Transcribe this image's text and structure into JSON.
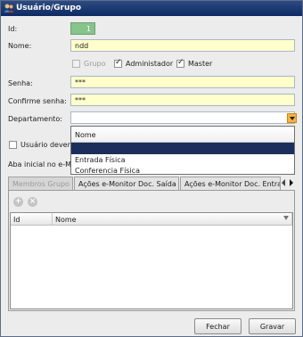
{
  "window": {
    "title": "Usuário/Grupo",
    "icon": "user-group-icon"
  },
  "form": {
    "id_label": "Id:",
    "id_value": "1",
    "nome_label": "Nome:",
    "nome_value": "ndd",
    "grupo_label": "Grupo",
    "grupo_checked": false,
    "grupo_enabled": false,
    "administrador_label": "Administador",
    "administrador_checked": true,
    "master_label": "Master",
    "master_checked": true,
    "senha_label": "Senha:",
    "senha_value": "***",
    "confirme_label": "Confirme senha:",
    "confirme_value": "***",
    "departamento_label": "Departamento:",
    "departamento_value": "",
    "usuario_devera_label": "Usuário deverá",
    "usuario_devera_checked": false,
    "aba_inicial_label": "Aba inicial no e-Mo"
  },
  "departamento_dropdown": {
    "header": "Nome",
    "options": [
      "",
      "Entrada Física",
      "Conferencia Física"
    ],
    "selected_index": 0
  },
  "tabs": [
    {
      "label": "Membros Grupo",
      "active": true
    },
    {
      "label": "Ações e-Monitor Doc. Saída",
      "active": false
    },
    {
      "label": "Ações e-Monitor Doc. Entrada",
      "active": false
    }
  ],
  "grid": {
    "add_icon": "add-icon",
    "remove_icon": "remove-icon",
    "columns": [
      "Id",
      "Nome"
    ],
    "rows": []
  },
  "buttons": {
    "fechar": "Fechar",
    "gravar": "Gravar"
  },
  "colors": {
    "title_bar": "#1a3570",
    "input_bg": "#ffffcc",
    "id_bg": "#86c48a",
    "selection": "#1c2f5c",
    "dropdown_button": "#f8b23b"
  }
}
